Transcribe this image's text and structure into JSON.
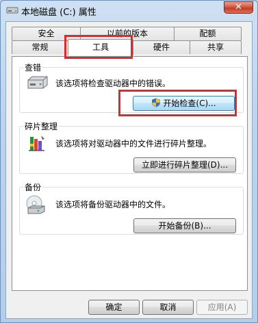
{
  "window": {
    "title": "本地磁盘 (C:) 属性",
    "close_label": "✕"
  },
  "tabs": {
    "top_row": [
      "安全",
      "以前的版本",
      "配额"
    ],
    "bottom_row": [
      "常规",
      "工具",
      "硬件",
      "共享"
    ],
    "selected": "工具"
  },
  "groups": {
    "error_check": {
      "title": "查错",
      "description": "该选项将检查驱动器中的错误。",
      "button_label": "开始检查(C)...",
      "icon": "drive-icon"
    },
    "defrag": {
      "title": "碎片整理",
      "description": "该选项将对驱动器中的文件进行碎片整理。",
      "button_label": "立即进行碎片整理(D)...",
      "icon": "defrag-icon"
    },
    "backup": {
      "title": "备份",
      "description": "该选项将备份驱动器中的文件。",
      "button_label": "开始备份(B)...",
      "icon": "backup-icon"
    }
  },
  "footer": {
    "ok_label": "确定",
    "cancel_label": "取消",
    "apply_label": "应用(A)"
  },
  "colors": {
    "highlight": "#e4262b",
    "window_frame": "#b9d1ea"
  }
}
